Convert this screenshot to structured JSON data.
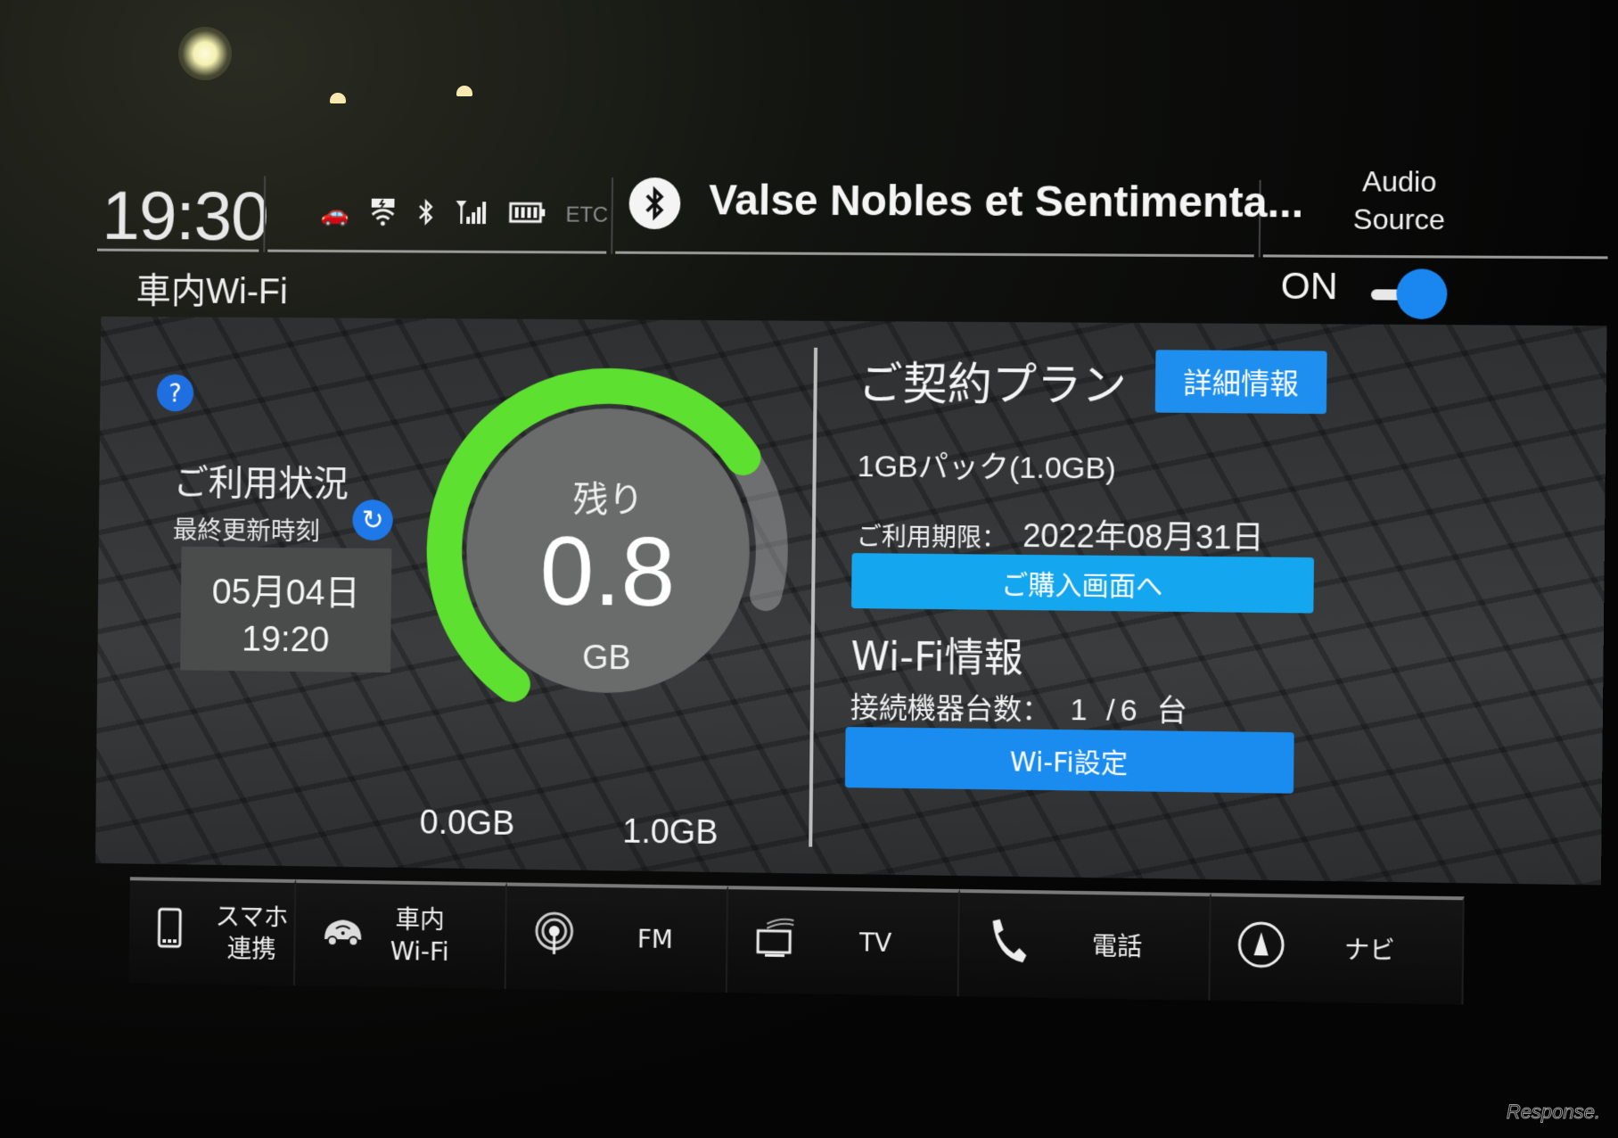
{
  "status_bar": {
    "clock": "19:30",
    "icons": [
      "car-connect-icon",
      "wifi-hotspot-icon",
      "bluetooth-icon",
      "cellular-signal-icon",
      "battery-icon"
    ],
    "etc_label": "ETC",
    "now_playing": "Valse Nobles et Sentimenta...",
    "audio_source_line1": "Audio",
    "audio_source_line2": "Source"
  },
  "header": {
    "title": "車内Wi-Fi",
    "toggle_label": "ON",
    "toggle_on": true
  },
  "usage": {
    "title": "ご利用状況",
    "last_updated_label": "最終更新時刻",
    "last_updated_date": "05月04日",
    "last_updated_time": "19:20"
  },
  "gauge": {
    "label": "残り",
    "value": "0.8",
    "unit": "GB",
    "min_label": "0.0GB",
    "max_label": "1.0GB",
    "remaining_fraction": 0.8,
    "fill_color": "#5de030"
  },
  "plan": {
    "title": "ご契約プラン",
    "details_button": "詳細情報",
    "plan_name": "1GBパック(1.0GB)",
    "expiry_label": "ご利用期限：",
    "expiry_value": "2022年08月31日",
    "purchase_button": "ご購入画面へ"
  },
  "wifi_info": {
    "title": "Wi-Fi情報",
    "devices_label": "接続機器台数：",
    "devices_value": "1 /6 台",
    "settings_button": "Wi-Fi設定"
  },
  "bottom_nav": [
    {
      "icon": "smartphone-icon",
      "label": "スマホ連携"
    },
    {
      "icon": "car-wifi-icon",
      "label": "車内\nWi-Fi"
    },
    {
      "icon": "radio-antenna-icon",
      "label": "FM"
    },
    {
      "icon": "tv-icon",
      "label": "TV"
    },
    {
      "icon": "phone-icon",
      "label": "電話"
    },
    {
      "icon": "navigation-icon",
      "label": "ナビ"
    }
  ],
  "colors": {
    "accent_blue": "#1a8cf0",
    "gauge_green": "#5de030"
  },
  "watermark": "Response."
}
